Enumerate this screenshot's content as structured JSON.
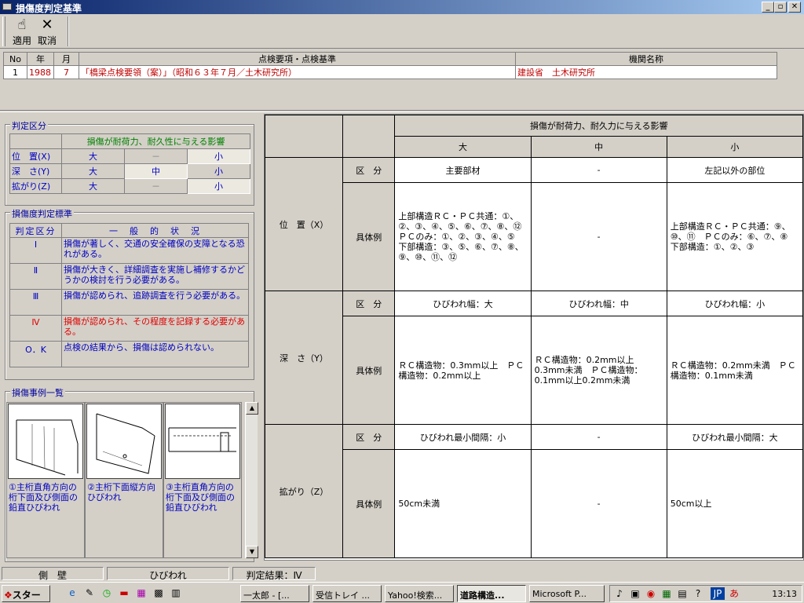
{
  "window": {
    "title": "損傷度判定基準",
    "min": "_",
    "max": "▫",
    "close": "✕"
  },
  "toolbar": {
    "apply_label": "適用",
    "cancel_label": "取消"
  },
  "top_table": {
    "headers": [
      "No",
      "年",
      "月",
      "点検要項・点検基準",
      "機関名称"
    ],
    "row": {
      "no": "1",
      "year": "1988",
      "month": "7",
      "standard": "「橋梁点検要領（案）」（昭和６３年７月／土木研究所）",
      "agency": "建設省　土木研究所"
    }
  },
  "judgment": {
    "group_title": "判定区分",
    "header": "損傷が耐荷力、耐久性に与える影響",
    "rows": [
      {
        "label": "位　置(X)",
        "large": "大",
        "medium": "－",
        "small": "小",
        "selected": "small"
      },
      {
        "label": "深　さ(Y)",
        "large": "大",
        "medium": "中",
        "small": "小",
        "selected": "medium"
      },
      {
        "label": "拡がり(Z)",
        "large": "大",
        "medium": "－",
        "small": "小",
        "selected": "small"
      }
    ]
  },
  "standard": {
    "group_title": "損傷度判定標準",
    "col_grade": "判定区分",
    "col_status": "一　般　的　状　況",
    "rows": [
      {
        "grade": "Ⅰ",
        "desc": "損傷が著しく、交通の安全確保の支障となる恐れがある。"
      },
      {
        "grade": "Ⅱ",
        "desc": "損傷が大きく、詳細調査を実施し補修するかどうかの検討を行う必要がある。"
      },
      {
        "grade": "Ⅲ",
        "desc": "損傷が認められ、追跡調査を行う必要がある。"
      },
      {
        "grade": "Ⅳ",
        "desc": "損傷が認められ、その程度を記録する必要がある。"
      },
      {
        "grade": "O．K",
        "desc": "点検の結果から、損傷は認められない。"
      }
    ]
  },
  "cases": {
    "group_title": "損傷事例一覧",
    "items": [
      {
        "caption": "①主桁直角方向の桁下面及び側面の鉛直ひびわれ"
      },
      {
        "caption": "②主桁下面縦方向ひびわれ"
      },
      {
        "caption": "③主桁直角方向の桁下面及び側面の鉛直ひびわれ"
      }
    ]
  },
  "matrix": {
    "title": "損傷が耐荷力、耐久力に与える影響",
    "levels": [
      "大",
      "中",
      "小"
    ],
    "label_kubun": "区　分",
    "label_example": "具体例",
    "x": {
      "label": "位　置（X）",
      "kubun": [
        "主要部材",
        "-",
        "左記以外の部位"
      ],
      "example": [
        "上部構造ＲＣ・ＰＣ共通：①、②、③、④、⑤、⑥、⑦、⑧、⑫　ＰＣのみ：①、②、③、④、⑤　下部構造：③、⑤、⑥、⑦、⑧、⑨、⑩、⑪、⑫",
        "-",
        "上部構造ＲＣ・ＰＣ共通：⑨、⑩、⑪　ＰＣのみ：⑥、⑦、⑧　下部構造：①、②、③"
      ]
    },
    "y": {
      "label": "深　さ（Y）",
      "kubun": [
        "ひびわれ幅：大",
        "ひびわれ幅：中",
        "ひびわれ幅：小"
      ],
      "example": [
        "ＲＣ構造物：0.3mm以上　ＰＣ構造物：0.2mm以上",
        "ＲＣ構造物：0.2mm以上0.3mm未満　ＰＣ構造物：0.1mm以上0.2mm未満",
        "ＲＣ構造物：0.2mm未満　ＰＣ構造物：0.1mm未満"
      ]
    },
    "z": {
      "label": "拡がり（Z）",
      "kubun": [
        "ひびわれ最小間隔：小",
        "-",
        "ひびわれ最小間隔：大"
      ],
      "example": [
        "50cm未満",
        "-",
        "50cm以上"
      ]
    }
  },
  "status": {
    "part": "側　壁",
    "damage": "ひびわれ",
    "result": "判定結果：Ⅳ"
  },
  "taskbar": {
    "start": "スタート",
    "tasks": [
      "一太郎 - [...",
      "受信トレイ ...",
      "Yahoo!検索...",
      "道路構造...",
      "Microsoft P..."
    ],
    "clock": "13:13"
  }
}
